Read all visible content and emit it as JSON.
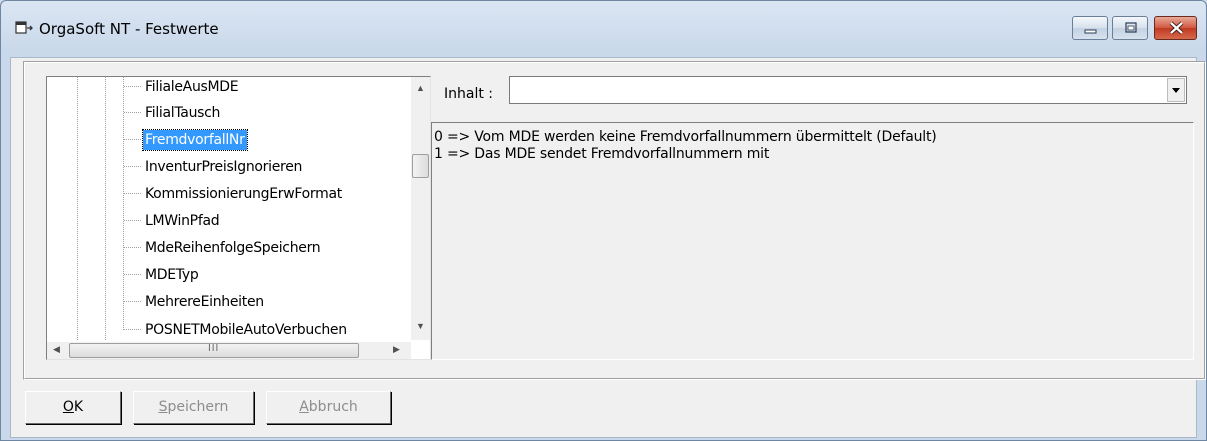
{
  "window": {
    "title": "OrgaSoft NT - Festwerte"
  },
  "tree": {
    "items": [
      {
        "label": "FilialeAusMDE"
      },
      {
        "label": "FilialTausch"
      },
      {
        "label": "FremdvorfallNr",
        "selected": true
      },
      {
        "label": "InventurPreisIgnorieren"
      },
      {
        "label": "KommissionierungErwFormat"
      },
      {
        "label": "LMWinPfad"
      },
      {
        "label": "MdeReihenfolgeSpeichern"
      },
      {
        "label": "MDETyp"
      },
      {
        "label": "MehrereEinheiten"
      },
      {
        "label": "POSNETMobileAutoVerbuchen"
      }
    ],
    "hscroll_glyph": "III"
  },
  "content": {
    "label": "Inhalt :",
    "value": ""
  },
  "description": {
    "lines": [
      "0 => Vom MDE werden keine Fremdvorfallnummern übermittelt (Default)",
      "1 => Das MDE sendet Fremdvorfallnummern mit"
    ]
  },
  "buttons": {
    "ok": {
      "underline": "O",
      "rest": "K",
      "enabled": true
    },
    "save": {
      "underline": "S",
      "rest": "peichern",
      "enabled": false
    },
    "cancel": {
      "underline": "A",
      "rest": "bbruch",
      "enabled": false
    }
  },
  "icons": {
    "app": "app-window-icon",
    "minimize": "minimize-icon",
    "maximize": "maximize-icon",
    "close": "close-icon",
    "dropdown": "chevron-down-icon"
  },
  "colors": {
    "selection": "#3399ff",
    "close_button": "#c03a22"
  }
}
